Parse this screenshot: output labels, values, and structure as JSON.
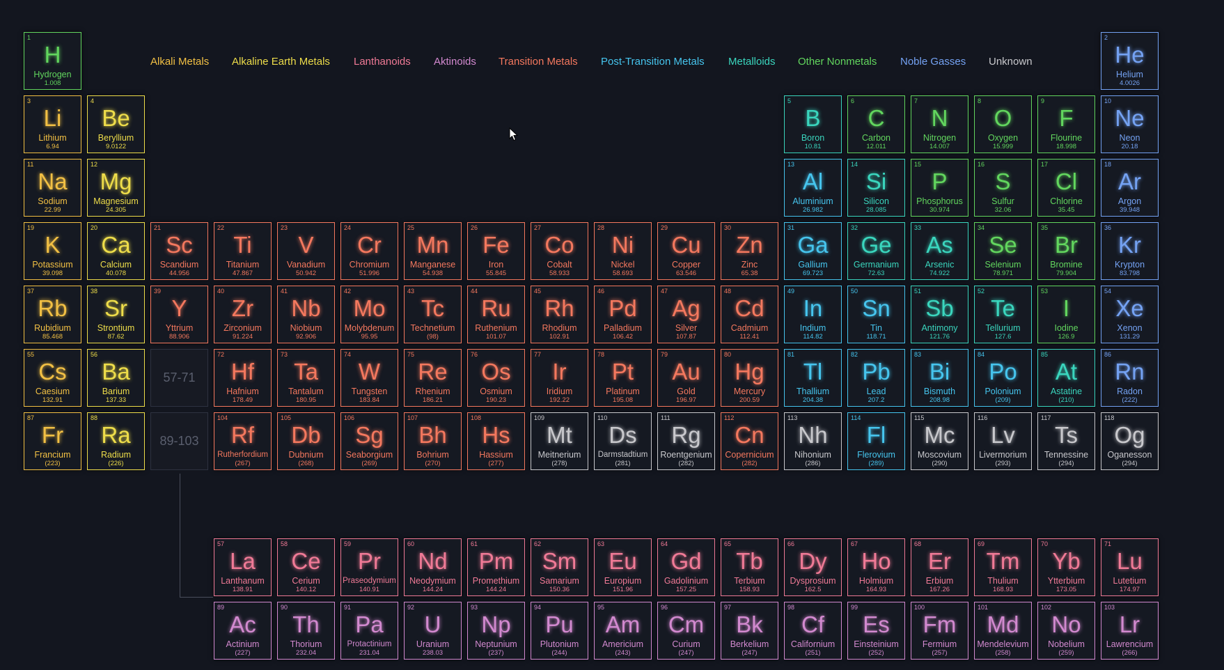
{
  "colors": {
    "alkali": "#f2c044",
    "alkaline": "#eedd4a",
    "lanthanoid": "#f07a96",
    "actinoid": "#d289cf",
    "transition": "#f4785e",
    "post": "#46c5ee",
    "metalloid": "#3ad6be",
    "nonmetal": "#62d65e",
    "noble": "#74a2f3",
    "unknown": "#c8c8cc"
  },
  "legend": [
    {
      "label": "Alkali Metals",
      "cat": "alkali"
    },
    {
      "label": "Alkaline Earth Metals",
      "cat": "alkaline"
    },
    {
      "label": "Lanthanoids",
      "cat": "lanthanoid"
    },
    {
      "label": "Aktinoids",
      "cat": "actinoid"
    },
    {
      "label": "Transition Metals",
      "cat": "transition"
    },
    {
      "label": "Post-Transition Metals",
      "cat": "post"
    },
    {
      "label": "Metalloids",
      "cat": "metalloid"
    },
    {
      "label": "Other Nonmetals",
      "cat": "nonmetal"
    },
    {
      "label": "Noble Gasses",
      "cat": "noble"
    },
    {
      "label": "Unknown",
      "cat": "unknown"
    }
  ],
  "placeholders": [
    {
      "label": "57-71"
    },
    {
      "label": "89-103"
    }
  ],
  "elements": [
    {
      "n": 1,
      "s": "H",
      "name": "Hydrogen",
      "m": "1.008",
      "cat": "nonmetal"
    },
    {
      "n": 2,
      "s": "He",
      "name": "Helium",
      "m": "4.0026",
      "cat": "noble"
    },
    {
      "n": 3,
      "s": "Li",
      "name": "Lithium",
      "m": "6.94",
      "cat": "alkali"
    },
    {
      "n": 4,
      "s": "Be",
      "name": "Beryllium",
      "m": "9.0122",
      "cat": "alkaline"
    },
    {
      "n": 5,
      "s": "B",
      "name": "Boron",
      "m": "10.81",
      "cat": "metalloid"
    },
    {
      "n": 6,
      "s": "C",
      "name": "Carbon",
      "m": "12.011",
      "cat": "nonmetal"
    },
    {
      "n": 7,
      "s": "N",
      "name": "Nitrogen",
      "m": "14.007",
      "cat": "nonmetal"
    },
    {
      "n": 8,
      "s": "O",
      "name": "Oxygen",
      "m": "15.999",
      "cat": "nonmetal"
    },
    {
      "n": 9,
      "s": "F",
      "name": "Flourine",
      "m": "18.998",
      "cat": "nonmetal"
    },
    {
      "n": 10,
      "s": "Ne",
      "name": "Neon",
      "m": "20.18",
      "cat": "noble"
    },
    {
      "n": 11,
      "s": "Na",
      "name": "Sodium",
      "m": "22.99",
      "cat": "alkali"
    },
    {
      "n": 12,
      "s": "Mg",
      "name": "Magnesium",
      "m": "24.305",
      "cat": "alkaline"
    },
    {
      "n": 13,
      "s": "Al",
      "name": "Aluminium",
      "m": "26.982",
      "cat": "post"
    },
    {
      "n": 14,
      "s": "Si",
      "name": "Silicon",
      "m": "28.085",
      "cat": "metalloid"
    },
    {
      "n": 15,
      "s": "P",
      "name": "Phosphorus",
      "m": "30.974",
      "cat": "nonmetal"
    },
    {
      "n": 16,
      "s": "S",
      "name": "Sulfur",
      "m": "32.06",
      "cat": "nonmetal"
    },
    {
      "n": 17,
      "s": "Cl",
      "name": "Chlorine",
      "m": "35.45",
      "cat": "nonmetal"
    },
    {
      "n": 18,
      "s": "Ar",
      "name": "Argon",
      "m": "39.948",
      "cat": "noble"
    },
    {
      "n": 19,
      "s": "K",
      "name": "Potassium",
      "m": "39.098",
      "cat": "alkali"
    },
    {
      "n": 20,
      "s": "Ca",
      "name": "Calcium",
      "m": "40.078",
      "cat": "alkaline"
    },
    {
      "n": 21,
      "s": "Sc",
      "name": "Scandium",
      "m": "44.956",
      "cat": "transition"
    },
    {
      "n": 22,
      "s": "Ti",
      "name": "Titanium",
      "m": "47.867",
      "cat": "transition"
    },
    {
      "n": 23,
      "s": "V",
      "name": "Vanadium",
      "m": "50.942",
      "cat": "transition"
    },
    {
      "n": 24,
      "s": "Cr",
      "name": "Chromium",
      "m": "51.996",
      "cat": "transition"
    },
    {
      "n": 25,
      "s": "Mn",
      "name": "Manganese",
      "m": "54.938",
      "cat": "transition"
    },
    {
      "n": 26,
      "s": "Fe",
      "name": "Iron",
      "m": "55.845",
      "cat": "transition"
    },
    {
      "n": 27,
      "s": "Co",
      "name": "Cobalt",
      "m": "58.933",
      "cat": "transition"
    },
    {
      "n": 28,
      "s": "Ni",
      "name": "Nickel",
      "m": "58.693",
      "cat": "transition"
    },
    {
      "n": 29,
      "s": "Cu",
      "name": "Copper",
      "m": "63.546",
      "cat": "transition"
    },
    {
      "n": 30,
      "s": "Zn",
      "name": "Zinc",
      "m": "65.38",
      "cat": "transition"
    },
    {
      "n": 31,
      "s": "Ga",
      "name": "Gallium",
      "m": "69.723",
      "cat": "post"
    },
    {
      "n": 32,
      "s": "Ge",
      "name": "Germanium",
      "m": "72.63",
      "cat": "metalloid"
    },
    {
      "n": 33,
      "s": "As",
      "name": "Arsenic",
      "m": "74.922",
      "cat": "metalloid"
    },
    {
      "n": 34,
      "s": "Se",
      "name": "Selenium",
      "m": "78.971",
      "cat": "nonmetal"
    },
    {
      "n": 35,
      "s": "Br",
      "name": "Bromine",
      "m": "79.904",
      "cat": "nonmetal"
    },
    {
      "n": 36,
      "s": "Kr",
      "name": "Krypton",
      "m": "83.798",
      "cat": "noble"
    },
    {
      "n": 37,
      "s": "Rb",
      "name": "Rubidium",
      "m": "85.468",
      "cat": "alkali"
    },
    {
      "n": 38,
      "s": "Sr",
      "name": "Strontium",
      "m": "87.62",
      "cat": "alkaline"
    },
    {
      "n": 39,
      "s": "Y",
      "name": "Yttrium",
      "m": "88.906",
      "cat": "transition"
    },
    {
      "n": 40,
      "s": "Zr",
      "name": "Zirconium",
      "m": "91.224",
      "cat": "transition"
    },
    {
      "n": 41,
      "s": "Nb",
      "name": "Niobium",
      "m": "92.906",
      "cat": "transition"
    },
    {
      "n": 42,
      "s": "Mo",
      "name": "Molybdenum",
      "m": "95.95",
      "cat": "transition"
    },
    {
      "n": 43,
      "s": "Tc",
      "name": "Technetium",
      "m": "(98)",
      "cat": "transition"
    },
    {
      "n": 44,
      "s": "Ru",
      "name": "Ruthenium",
      "m": "101.07",
      "cat": "transition"
    },
    {
      "n": 45,
      "s": "Rh",
      "name": "Rhodium",
      "m": "102.91",
      "cat": "transition"
    },
    {
      "n": 46,
      "s": "Pd",
      "name": "Palladium",
      "m": "106.42",
      "cat": "transition"
    },
    {
      "n": 47,
      "s": "Ag",
      "name": "Silver",
      "m": "107.87",
      "cat": "transition"
    },
    {
      "n": 48,
      "s": "Cd",
      "name": "Cadmium",
      "m": "112.41",
      "cat": "transition"
    },
    {
      "n": 49,
      "s": "In",
      "name": "Indium",
      "m": "114.82",
      "cat": "post"
    },
    {
      "n": 50,
      "s": "Sn",
      "name": "Tin",
      "m": "118.71",
      "cat": "post"
    },
    {
      "n": 51,
      "s": "Sb",
      "name": "Antimony",
      "m": "121.76",
      "cat": "metalloid"
    },
    {
      "n": 52,
      "s": "Te",
      "name": "Tellurium",
      "m": "127.6",
      "cat": "metalloid"
    },
    {
      "n": 53,
      "s": "I",
      "name": "Iodine",
      "m": "126.9",
      "cat": "nonmetal"
    },
    {
      "n": 54,
      "s": "Xe",
      "name": "Xenon",
      "m": "131.29",
      "cat": "noble"
    },
    {
      "n": 55,
      "s": "Cs",
      "name": "Caesium",
      "m": "132.91",
      "cat": "alkali"
    },
    {
      "n": 56,
      "s": "Ba",
      "name": "Barium",
      "m": "137.33",
      "cat": "alkaline"
    },
    {
      "n": 72,
      "s": "Hf",
      "name": "Hafnium",
      "m": "178.49",
      "cat": "transition"
    },
    {
      "n": 73,
      "s": "Ta",
      "name": "Tantalum",
      "m": "180.95",
      "cat": "transition"
    },
    {
      "n": 74,
      "s": "W",
      "name": "Tungsten",
      "m": "183.84",
      "cat": "transition"
    },
    {
      "n": 75,
      "s": "Re",
      "name": "Rhenium",
      "m": "186.21",
      "cat": "transition"
    },
    {
      "n": 76,
      "s": "Os",
      "name": "Osmium",
      "m": "190.23",
      "cat": "transition"
    },
    {
      "n": 77,
      "s": "Ir",
      "name": "Iridium",
      "m": "192.22",
      "cat": "transition"
    },
    {
      "n": 78,
      "s": "Pt",
      "name": "Platinum",
      "m": "195.08",
      "cat": "transition"
    },
    {
      "n": 79,
      "s": "Au",
      "name": "Gold",
      "m": "196.97",
      "cat": "transition"
    },
    {
      "n": 80,
      "s": "Hg",
      "name": "Mercury",
      "m": "200.59",
      "cat": "transition"
    },
    {
      "n": 81,
      "s": "Tl",
      "name": "Thallium",
      "m": "204.38",
      "cat": "post"
    },
    {
      "n": 82,
      "s": "Pb",
      "name": "Lead",
      "m": "207.2",
      "cat": "post"
    },
    {
      "n": 83,
      "s": "Bi",
      "name": "Bismuth",
      "m": "208.98",
      "cat": "post"
    },
    {
      "n": 84,
      "s": "Po",
      "name": "Polonium",
      "m": "(209)",
      "cat": "post"
    },
    {
      "n": 85,
      "s": "At",
      "name": "Astatine",
      "m": "(210)",
      "cat": "metalloid"
    },
    {
      "n": 86,
      "s": "Rn",
      "name": "Radon",
      "m": "(222)",
      "cat": "noble"
    },
    {
      "n": 87,
      "s": "Fr",
      "name": "Francium",
      "m": "(223)",
      "cat": "alkali"
    },
    {
      "n": 88,
      "s": "Ra",
      "name": "Radium",
      "m": "(226)",
      "cat": "alkaline"
    },
    {
      "n": 104,
      "s": "Rf",
      "name": "Rutherfordium",
      "m": "(267)",
      "cat": "transition"
    },
    {
      "n": 105,
      "s": "Db",
      "name": "Dubnium",
      "m": "(268)",
      "cat": "transition"
    },
    {
      "n": 106,
      "s": "Sg",
      "name": "Seaborgium",
      "m": "(269)",
      "cat": "transition"
    },
    {
      "n": 107,
      "s": "Bh",
      "name": "Bohrium",
      "m": "(270)",
      "cat": "transition"
    },
    {
      "n": 108,
      "s": "Hs",
      "name": "Hassium",
      "m": "(277)",
      "cat": "transition"
    },
    {
      "n": 109,
      "s": "Mt",
      "name": "Meitnerium",
      "m": "(278)",
      "cat": "unknown"
    },
    {
      "n": 110,
      "s": "Ds",
      "name": "Darmstadtium",
      "m": "(281)",
      "cat": "unknown"
    },
    {
      "n": 111,
      "s": "Rg",
      "name": "Roentgenium",
      "m": "(282)",
      "cat": "unknown"
    },
    {
      "n": 112,
      "s": "Cn",
      "name": "Copernicium",
      "m": "(282)",
      "cat": "transition"
    },
    {
      "n": 113,
      "s": "Nh",
      "name": "Nihonium",
      "m": "(286)",
      "cat": "unknown"
    },
    {
      "n": 114,
      "s": "Fl",
      "name": "Flerovium",
      "m": "(289)",
      "cat": "post"
    },
    {
      "n": 115,
      "s": "Mc",
      "name": "Moscovium",
      "m": "(290)",
      "cat": "unknown"
    },
    {
      "n": 116,
      "s": "Lv",
      "name": "Livermorium",
      "m": "(293)",
      "cat": "unknown"
    },
    {
      "n": 117,
      "s": "Ts",
      "name": "Tennessine",
      "m": "(294)",
      "cat": "unknown"
    },
    {
      "n": 118,
      "s": "Og",
      "name": "Oganesson",
      "m": "(294)",
      "cat": "unknown"
    },
    {
      "n": 57,
      "s": "La",
      "name": "Lanthanum",
      "m": "138.91",
      "cat": "lanthanoid"
    },
    {
      "n": 58,
      "s": "Ce",
      "name": "Cerium",
      "m": "140.12",
      "cat": "lanthanoid"
    },
    {
      "n": 59,
      "s": "Pr",
      "name": "Praseodymium",
      "m": "140.91",
      "cat": "lanthanoid"
    },
    {
      "n": 60,
      "s": "Nd",
      "name": "Neodymium",
      "m": "144.24",
      "cat": "lanthanoid"
    },
    {
      "n": 61,
      "s": "Pm",
      "name": "Promethium",
      "m": "144.24",
      "cat": "lanthanoid"
    },
    {
      "n": 62,
      "s": "Sm",
      "name": "Samarium",
      "m": "150.36",
      "cat": "lanthanoid"
    },
    {
      "n": 63,
      "s": "Eu",
      "name": "Europium",
      "m": "151.96",
      "cat": "lanthanoid"
    },
    {
      "n": 64,
      "s": "Gd",
      "name": "Gadolinium",
      "m": "157.25",
      "cat": "lanthanoid"
    },
    {
      "n": 65,
      "s": "Tb",
      "name": "Terbium",
      "m": "158.93",
      "cat": "lanthanoid"
    },
    {
      "n": 66,
      "s": "Dy",
      "name": "Dysprosium",
      "m": "162.5",
      "cat": "lanthanoid"
    },
    {
      "n": 67,
      "s": "Ho",
      "name": "Holmium",
      "m": "164.93",
      "cat": "lanthanoid"
    },
    {
      "n": 68,
      "s": "Er",
      "name": "Erbium",
      "m": "167.26",
      "cat": "lanthanoid"
    },
    {
      "n": 69,
      "s": "Tm",
      "name": "Thulium",
      "m": "168.93",
      "cat": "lanthanoid"
    },
    {
      "n": 70,
      "s": "Yb",
      "name": "Ytterbium",
      "m": "173.05",
      "cat": "lanthanoid"
    },
    {
      "n": 71,
      "s": "Lu",
      "name": "Lutetium",
      "m": "174.97",
      "cat": "lanthanoid"
    },
    {
      "n": 89,
      "s": "Ac",
      "name": "Actinium",
      "m": "(227)",
      "cat": "actinoid"
    },
    {
      "n": 90,
      "s": "Th",
      "name": "Thorium",
      "m": "232.04",
      "cat": "actinoid"
    },
    {
      "n": 91,
      "s": "Pa",
      "name": "Protactinium",
      "m": "231.04",
      "cat": "actinoid"
    },
    {
      "n": 92,
      "s": "U",
      "name": "Uranium",
      "m": "238.03",
      "cat": "actinoid"
    },
    {
      "n": 93,
      "s": "Np",
      "name": "Neptunium",
      "m": "(237)",
      "cat": "actinoid"
    },
    {
      "n": 94,
      "s": "Pu",
      "name": "Plutonium",
      "m": "(244)",
      "cat": "actinoid"
    },
    {
      "n": 95,
      "s": "Am",
      "name": "Americium",
      "m": "(243)",
      "cat": "actinoid"
    },
    {
      "n": 96,
      "s": "Cm",
      "name": "Curium",
      "m": "(247)",
      "cat": "actinoid"
    },
    {
      "n": 97,
      "s": "Bk",
      "name": "Berkelium",
      "m": "(247)",
      "cat": "actinoid"
    },
    {
      "n": 98,
      "s": "Cf",
      "name": "Californium",
      "m": "(251)",
      "cat": "actinoid"
    },
    {
      "n": 99,
      "s": "Es",
      "name": "Einsteinium",
      "m": "(252)",
      "cat": "actinoid"
    },
    {
      "n": 100,
      "s": "Fm",
      "name": "Fermium",
      "m": "(257)",
      "cat": "actinoid"
    },
    {
      "n": 101,
      "s": "Md",
      "name": "Mendelevium",
      "m": "(258)",
      "cat": "actinoid"
    },
    {
      "n": 102,
      "s": "No",
      "name": "Nobelium",
      "m": "(259)",
      "cat": "actinoid"
    },
    {
      "n": 103,
      "s": "Lr",
      "name": "Lawrencium",
      "m": "(266)",
      "cat": "actinoid"
    }
  ]
}
